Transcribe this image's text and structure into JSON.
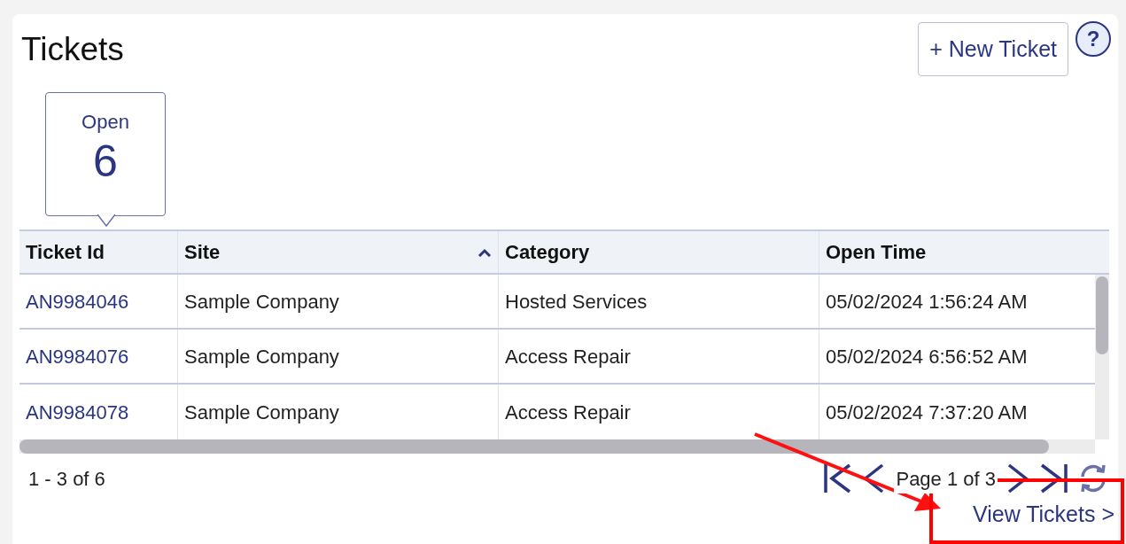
{
  "title": "Tickets",
  "new_ticket_button": "+ New Ticket",
  "help_button": "?",
  "status_tiles": [
    {
      "label": "Open",
      "count": "6",
      "selected": true
    }
  ],
  "table": {
    "columns": [
      {
        "label": "Ticket Id",
        "sorted": false
      },
      {
        "label": "Site",
        "sorted": true
      },
      {
        "label": "Category",
        "sorted": false
      },
      {
        "label": "Open Time",
        "sorted": false
      }
    ],
    "rows": [
      [
        "AN9984046",
        "Sample Company",
        "Hosted Services",
        "05/02/2024 1:56:24 AM"
      ],
      [
        "AN9984076",
        "Sample Company",
        "Access Repair",
        "05/02/2024 6:56:52 AM"
      ],
      [
        "AN9984078",
        "Sample Company",
        "Access Repair",
        "05/02/2024 7:37:20 AM"
      ]
    ]
  },
  "pager": {
    "range": "1 - 3 of 6",
    "page_label": "Page 1 of 3"
  },
  "view_link": "View Tickets >"
}
